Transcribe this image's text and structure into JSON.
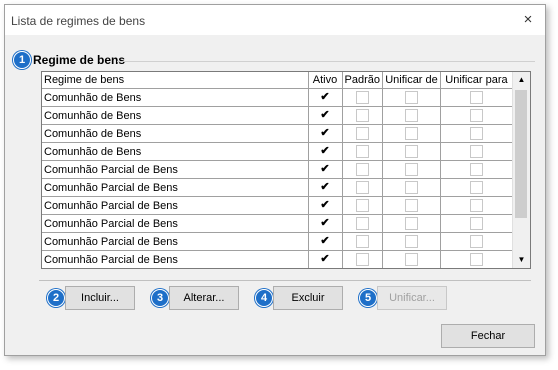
{
  "window": {
    "title": "Lista de regimes de bens",
    "close": "×"
  },
  "group": {
    "title": "Regime de bens",
    "badge": "1"
  },
  "table": {
    "columns": [
      "Regime de bens",
      "Ativo",
      "Padrão",
      "Unificar de",
      "Unificar para"
    ],
    "rows": [
      {
        "name": "Comunhão de Bens",
        "ativo": true,
        "padrao": false,
        "unificar_de": false,
        "unificar_para": false
      },
      {
        "name": "Comunhão de Bens",
        "ativo": true,
        "padrao": false,
        "unificar_de": false,
        "unificar_para": false
      },
      {
        "name": "Comunhão de Bens",
        "ativo": true,
        "padrao": false,
        "unificar_de": false,
        "unificar_para": false
      },
      {
        "name": "Comunhão de Bens",
        "ativo": true,
        "padrao": false,
        "unificar_de": false,
        "unificar_para": false
      },
      {
        "name": "Comunhão Parcial de Bens",
        "ativo": true,
        "padrao": false,
        "unificar_de": false,
        "unificar_para": false
      },
      {
        "name": "Comunhão Parcial de Bens",
        "ativo": true,
        "padrao": false,
        "unificar_de": false,
        "unificar_para": false
      },
      {
        "name": "Comunhão Parcial de Bens",
        "ativo": true,
        "padrao": false,
        "unificar_de": false,
        "unificar_para": false
      },
      {
        "name": "Comunhão Parcial de Bens",
        "ativo": true,
        "padrao": false,
        "unificar_de": false,
        "unificar_para": false
      },
      {
        "name": "Comunhão Parcial de Bens",
        "ativo": true,
        "padrao": false,
        "unificar_de": false,
        "unificar_para": false
      },
      {
        "name": "Comunhão Parcial de Bens",
        "ativo": true,
        "padrao": false,
        "unificar_de": false,
        "unificar_para": false
      }
    ]
  },
  "buttons": {
    "incluir": {
      "badge": "2",
      "label": "Incluir..."
    },
    "alterar": {
      "badge": "3",
      "label": "Alterar..."
    },
    "excluir": {
      "badge": "4",
      "label": "Excluir"
    },
    "unificar": {
      "badge": "5",
      "label": "Unificar..."
    },
    "fechar": {
      "label": "Fechar"
    }
  },
  "icons": {
    "check": "✔",
    "scroll_up": "▲",
    "scroll_down": "▼"
  },
  "colors": {
    "badge": "#1e6fc8",
    "window_bg": "#f0f0f0"
  }
}
